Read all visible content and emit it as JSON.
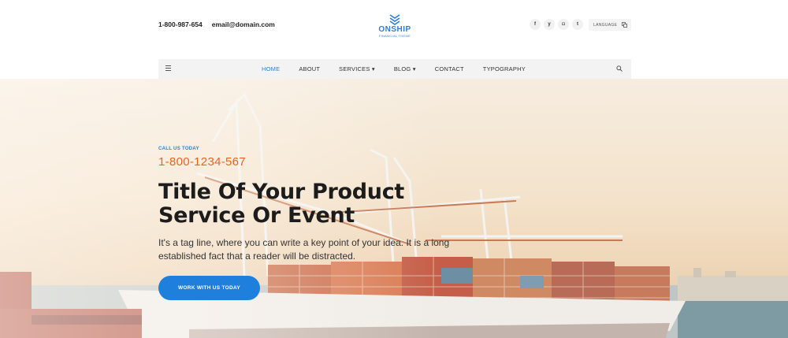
{
  "header": {
    "phone": "1-800-987-654",
    "email": "email@domain.com",
    "logo_name": "ONSHIP",
    "logo_tagline": "FINANCIAL THEME",
    "social": [
      {
        "icon": "facebook-icon",
        "glyph": "f"
      },
      {
        "icon": "twitter-icon",
        "glyph": "y"
      },
      {
        "icon": "instagram-icon",
        "glyph": "◘"
      },
      {
        "icon": "tumblr-icon",
        "glyph": "t"
      }
    ],
    "language_label": "LANGUAGE",
    "language_icon": "translate-icon"
  },
  "nav": {
    "menu_icon": "hamburger-icon",
    "search_icon": "search-icon",
    "items": [
      {
        "label": "HOME",
        "active": true
      },
      {
        "label": "ABOUT",
        "active": false
      },
      {
        "label": "SERVICES ▾",
        "active": false
      },
      {
        "label": "BLOG ▾",
        "active": false
      },
      {
        "label": "CONTACT",
        "active": false
      },
      {
        "label": "TYPOGRAPHY",
        "active": false
      }
    ],
    "accent_color": "#2d7fd6"
  },
  "hero": {
    "call_label": "CALL US TODAY",
    "call_phone": "1-800-1234-567",
    "title_line1": "Title Of Your Product",
    "title_line2": "Service Or Event",
    "tagline": "It's a tag line, where you can write a key point of your idea. It is a long established fact that a reader will be distracted.",
    "cta_label": "WORK WITH US TODAY",
    "phone_color": "#e8651f",
    "cta_color": "#1f7fdc"
  }
}
